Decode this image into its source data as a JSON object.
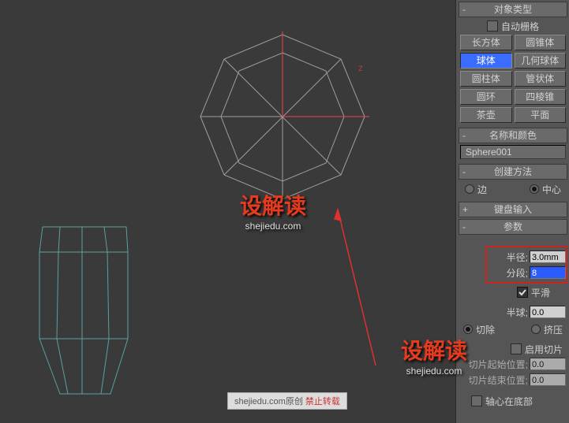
{
  "object_type": {
    "title": "对象类型",
    "pm": "-",
    "autogrid_label": "自动栅格",
    "buttons": [
      [
        "长方体",
        "圆锥体"
      ],
      [
        "球体",
        "几何球体"
      ],
      [
        "圆柱体",
        "管状体"
      ],
      [
        "圆环",
        "四棱锥"
      ],
      [
        "茶壶",
        "平面"
      ]
    ],
    "selected": "球体"
  },
  "name_color": {
    "title": "名称和颜色",
    "pm": "-",
    "name": "Sphere001"
  },
  "creation": {
    "title": "创建方法",
    "pm": "-",
    "edge": "边",
    "center": "中心"
  },
  "kb_entry": {
    "title": "键盘输入",
    "pm": "+"
  },
  "params": {
    "title": "参数",
    "pm": "-",
    "radius_label": "半径;",
    "radius_value": "3.0mm",
    "segments_label": "分段;",
    "segments_value": "8",
    "smooth_label": "平滑",
    "hemi_label": "半球;",
    "hemi_value": "0.0",
    "chop_label": "切除",
    "squash_label": "挤压",
    "slice_on_label": "启用切片",
    "slice_from_label": "切片起始位置;",
    "slice_from_value": "0.0",
    "slice_to_label": "切片结束位置;",
    "slice_to_value": "0.0",
    "base_pivot_label": "轴心在底部"
  },
  "watermark": {
    "logo": "设解读",
    "url": "shejiedu.com",
    "footer1": "shejiedu.com原创",
    "footer2": "禁止转载"
  }
}
